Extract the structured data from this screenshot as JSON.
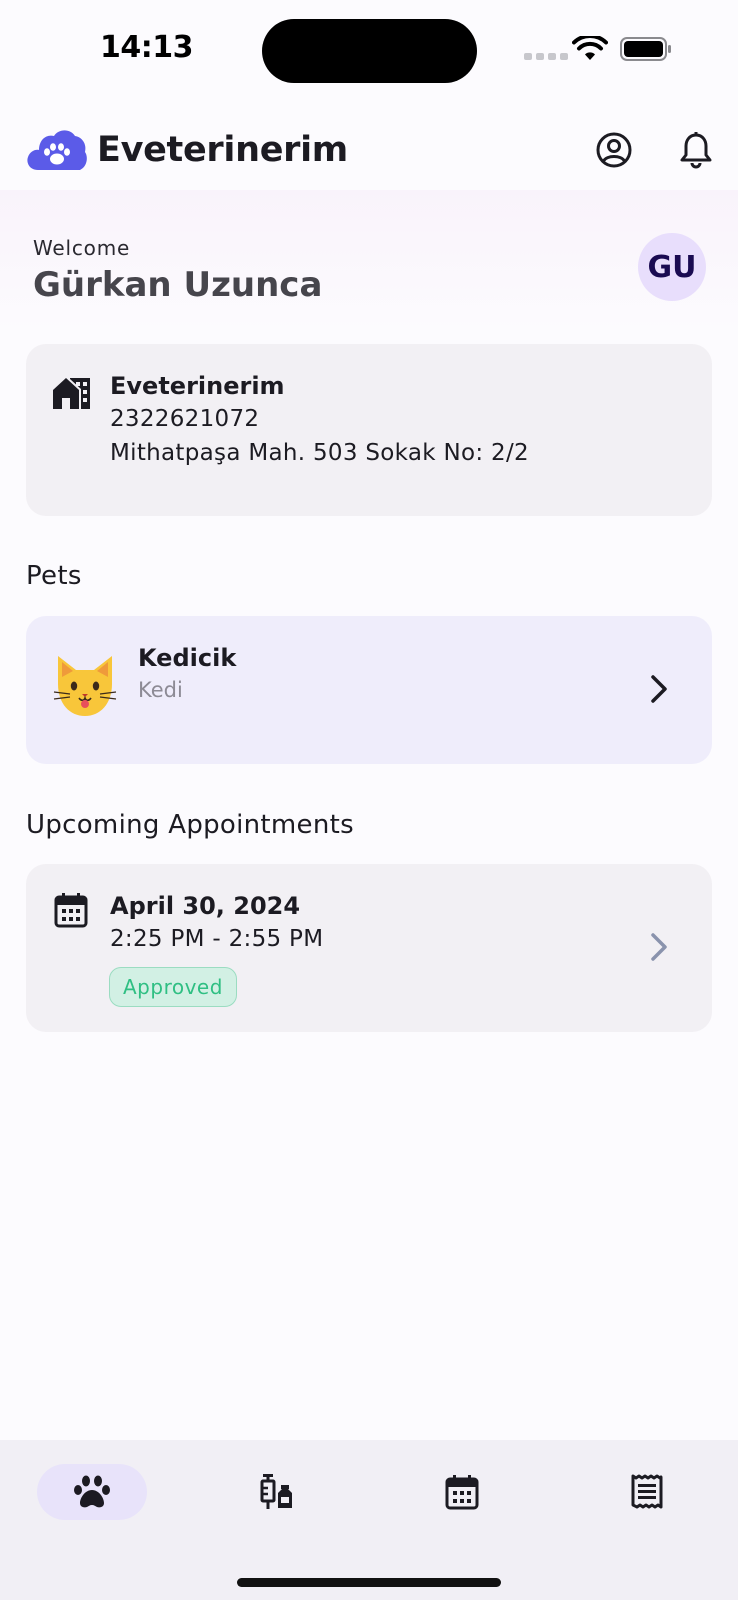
{
  "status_bar": {
    "time": "14:13"
  },
  "app_bar": {
    "title": "Eveterinerim",
    "logo_icon": "cloud-paw-icon",
    "profile_icon": "account-circle-icon",
    "bell_icon": "bell-icon"
  },
  "welcome": {
    "label": "Welcome",
    "user_name": "Gürkan Uzunca",
    "avatar_initials": "GU"
  },
  "clinic": {
    "icon": "clinic-building-icon",
    "name": "Eveterinerim",
    "phone": "2322621072",
    "address": "Mithatpaşa Mah. 503 Sokak No: 2/2"
  },
  "pets": {
    "title": "Pets",
    "items": [
      {
        "name": "Kedicik",
        "type": "Kedi",
        "emoji": "😺"
      }
    ]
  },
  "appointments": {
    "title": "Upcoming Appointments",
    "items": [
      {
        "date": "April 30, 2024",
        "time": "2:25 PM - 2:55 PM",
        "status": "Approved"
      }
    ]
  },
  "bottom_nav": {
    "active_index": 0,
    "items": [
      {
        "icon": "paw-icon"
      },
      {
        "icon": "vaccine-icon"
      },
      {
        "icon": "calendar-icon"
      },
      {
        "icon": "receipt-icon"
      }
    ]
  },
  "colors": {
    "accent": "#5b5be8",
    "approved": "#2fbf83",
    "avatar_bg": "#e8defc",
    "pet_card_bg": "#efedfb"
  }
}
